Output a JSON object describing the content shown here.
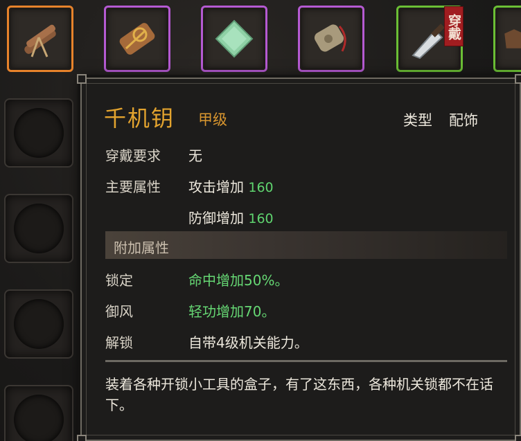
{
  "slots": [
    {
      "rarity": "orange",
      "icon": "bundle-of-logs-icon",
      "worn": false
    },
    {
      "rarity": "purple",
      "icon": "golden-scroll-icon",
      "worn": false
    },
    {
      "rarity": "purple",
      "icon": "jade-stone-icon",
      "worn": false
    },
    {
      "rarity": "purple",
      "icon": "talisman-pouch-icon",
      "worn": false
    },
    {
      "rarity": "green",
      "icon": "cleaver-knife-icon",
      "worn": true,
      "worn_label": "穿戴"
    },
    {
      "rarity": "green",
      "icon": "armor-icon",
      "worn": false
    }
  ],
  "tooltip": {
    "name": "千机钥",
    "grade": "甲级",
    "type_label": "类型",
    "type_value": "配饰",
    "requirement_label": "穿戴要求",
    "requirement_value": "无",
    "main_attr_label": "主要属性",
    "main_attrs": [
      {
        "text": "攻击增加",
        "value": "160"
      },
      {
        "text": "防御增加",
        "value": "160"
      }
    ],
    "extra_section_title": "附加属性",
    "extra_attrs": [
      {
        "name": "锁定",
        "effect": "命中增加50%。",
        "color": "#66d874"
      },
      {
        "name": "御风",
        "effect": "轻功增加70。",
        "color": "#66d874"
      },
      {
        "name": "解锁",
        "effect": "自带4级机关能力。",
        "color": "#ece7dc"
      }
    ],
    "description": "装着各种开锁小工具的盒子，有了这东西，各种机关锁都不在话下。"
  },
  "colors": {
    "orange": "#e7832b",
    "purple": "#b55ad2",
    "green": "#6bbf35",
    "name_gold": "#e3a32e",
    "stat_green": "#5fd46f"
  }
}
